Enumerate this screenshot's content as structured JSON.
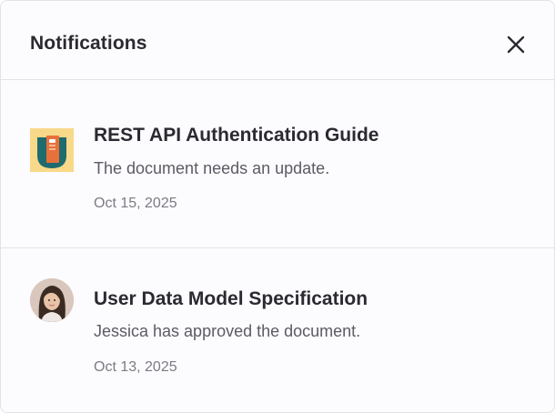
{
  "header": {
    "title": "Notifications",
    "close_icon": "close-icon"
  },
  "notifications": [
    {
      "icon": "document-folder-icon",
      "title": "REST API Authentication Guide",
      "message": "The document needs an update.",
      "date": "Oct 15, 2025"
    },
    {
      "icon": "user-avatar",
      "title": "User Data Model Specification",
      "message": "Jessica has approved the document.",
      "date": "Oct 13, 2025"
    }
  ],
  "colors": {
    "panel_background": "#fcfbfd",
    "divider": "#e4e2e7",
    "title_text": "#2b2a30",
    "message_text": "#5d5b63",
    "date_text": "#7d7b83",
    "thumbnail_background": "#f8d98a",
    "folder_teal": "#1f6b6e",
    "folder_orange": "#e8703a"
  }
}
